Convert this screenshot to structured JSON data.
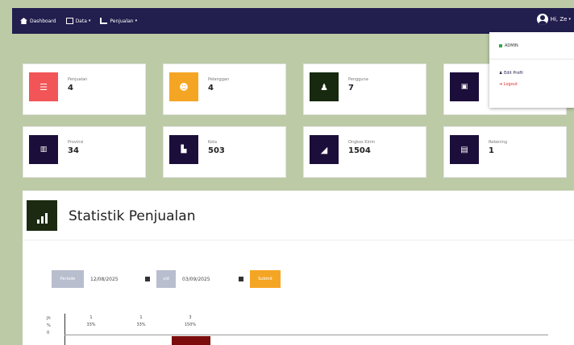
{
  "navbar": {
    "dashboard": "Dashboard",
    "data": "Data",
    "penjualan": "Penjualan",
    "user": "Hi, Ze"
  },
  "dropdown": {
    "role": "ADMIN",
    "edit_profil": "Edit Profil",
    "logout": "Logout"
  },
  "cards": [
    {
      "label": "Penjualan",
      "value": "4",
      "color": "#f25557",
      "icon": "list-icon"
    },
    {
      "label": "Pelanggan",
      "value": "4",
      "color": "#f5a524",
      "icon": "users-icon"
    },
    {
      "label": "Pengguna",
      "value": "7",
      "color": "#17290f",
      "icon": "user-icon"
    },
    {
      "label": "",
      "value": "",
      "color": "#1c0e3a",
      "icon": "truck-icon"
    },
    {
      "label": "Provinsi",
      "value": "34",
      "color": "#1c0e3a",
      "icon": "map-icon"
    },
    {
      "label": "Kota",
      "value": "503",
      "color": "#1c0e3a",
      "icon": "city-icon"
    },
    {
      "label": "Ongkos Kirim",
      "value": "1504",
      "color": "#1c0e3a",
      "icon": "send-icon"
    },
    {
      "label": "Rekening",
      "value": "1",
      "color": "#1c0e3a",
      "icon": "card-icon"
    }
  ],
  "statistik": {
    "title": "Statistik Penjualan",
    "start_label": "Periode",
    "start_date": "12/08/2025",
    "end_label": "s/d",
    "end_date": "03/09/2025",
    "submit": "Submit"
  },
  "chart": {
    "y_labels": [
      "Jh",
      "%",
      "0"
    ],
    "columns": [
      {
        "count": "1",
        "pct": "33%"
      },
      {
        "count": "1",
        "pct": "33%"
      },
      {
        "count": "3",
        "pct": "150%"
      }
    ]
  }
}
